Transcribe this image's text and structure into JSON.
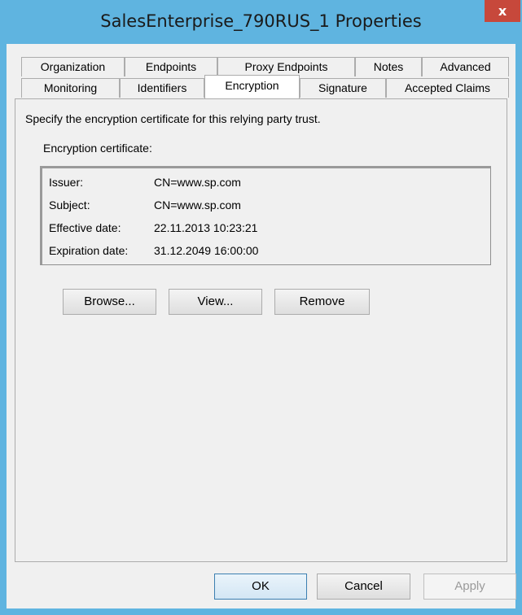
{
  "window": {
    "title": "SalesEnterprise_790RUS_1 Properties",
    "close": "x"
  },
  "tabs_back": [
    "Organization",
    "Endpoints",
    "Proxy Endpoints",
    "Notes",
    "Advanced"
  ],
  "tabs_front": [
    "Monitoring",
    "Identifiers",
    "Encryption",
    "Signature",
    "Accepted Claims"
  ],
  "active_tab": "Encryption",
  "panel": {
    "description": "Specify the encryption certificate for this relying party trust.",
    "cert_label": "Encryption certificate:",
    "cert": [
      {
        "key": "Issuer:",
        "value": "CN=www.sp.com"
      },
      {
        "key": "Subject:",
        "value": "CN=www.sp.com"
      },
      {
        "key": "Effective date:",
        "value": "22.11.2013 10:23:21"
      },
      {
        "key": "Expiration date:",
        "value": "31.12.2049 16:00:00"
      }
    ],
    "buttons": {
      "browse": "Browse...",
      "view": "View...",
      "remove": "Remove"
    }
  },
  "footer": {
    "ok": "OK",
    "cancel": "Cancel",
    "apply": "Apply"
  }
}
